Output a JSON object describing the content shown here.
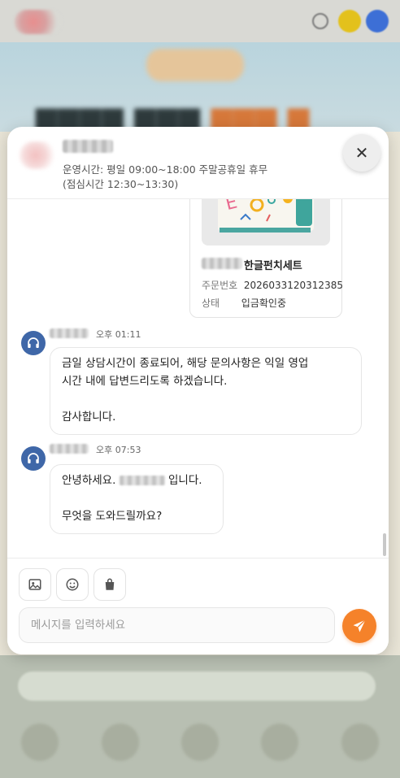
{
  "header": {
    "hours": "운영시간: 평일 09:00~18:00 주말공휴일 휴무",
    "lunch": "(점심시간 12:30~13:30)",
    "close_glyph": "✕"
  },
  "order_card": {
    "product_suffix": "한글펀치세트",
    "order_no_label": "주문번호",
    "order_no": "2026033120312385",
    "status_label": "상태",
    "status": "입금확인중"
  },
  "messages": [
    {
      "time": "오후 01:11",
      "lines": [
        "금일 상담시간이 종료되어, 해당 문의사항은 익일 영업",
        "시간 내에 답변드리도록 하겠습니다."
      ],
      "closing": "감사합니다."
    },
    {
      "time": "오후 07:53",
      "greeting_prefix": "안녕하세요.",
      "greeting_suffix": "입니다.",
      "question": "무엇을 도와드릴까요?"
    }
  ],
  "composer": {
    "placeholder": "메시지를 입력하세요"
  },
  "colors": {
    "accent": "#f5822a",
    "agent_avatar": "#3f67a8",
    "header_badge_yellow": "#f2d200",
    "header_badge_blue": "#3d6fd6"
  },
  "icons": [
    "search-icon",
    "close-icon",
    "headset-icon",
    "image-icon",
    "emoji-icon",
    "shopping-bag-icon",
    "send-icon"
  ]
}
